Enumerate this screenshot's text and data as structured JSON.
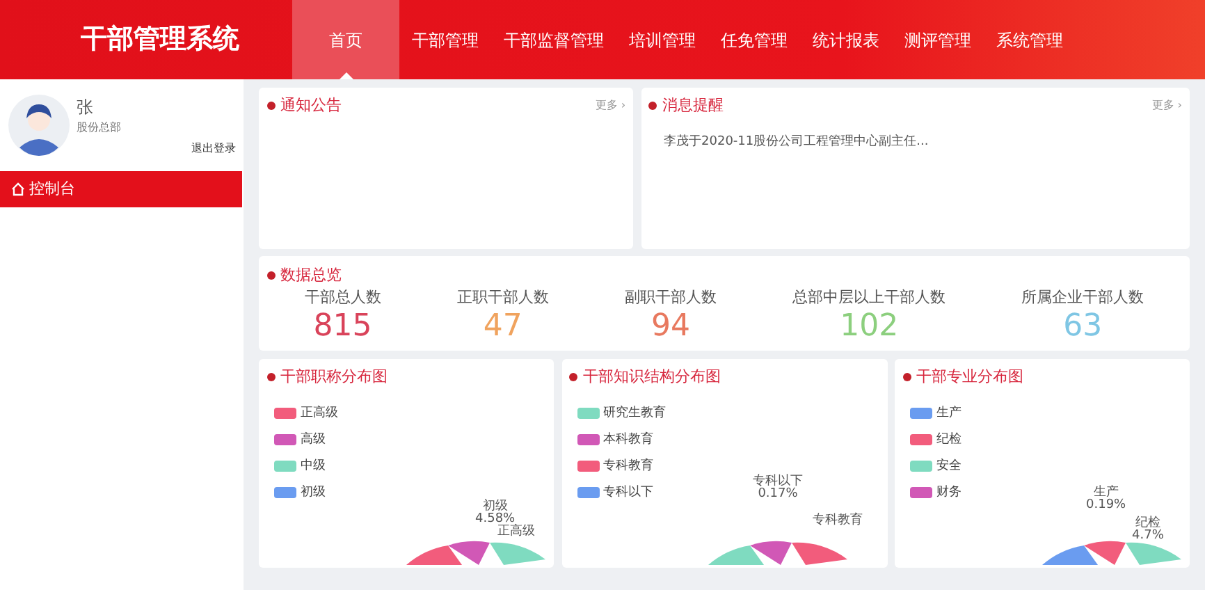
{
  "header": {
    "title": "干部管理系统",
    "nav": [
      {
        "label": "首页",
        "selected": true
      },
      {
        "label": "干部管理",
        "selected": false
      },
      {
        "label": "干部监督管理",
        "selected": false
      },
      {
        "label": "培训管理",
        "selected": false
      },
      {
        "label": "任免管理",
        "selected": false
      },
      {
        "label": "统计报表",
        "selected": false
      },
      {
        "label": "测评管理",
        "selected": false
      },
      {
        "label": "系统管理",
        "selected": false
      }
    ]
  },
  "user": {
    "name": "张",
    "role": "股份总部",
    "logout": "退出登录"
  },
  "sidebar": {
    "items": [
      {
        "label": "控制台",
        "selected": true
      }
    ]
  },
  "panels": [
    {
      "title": "通知公告",
      "more": "更多 ›"
    },
    {
      "title": "消息提醒",
      "more": "更多 ›",
      "items": [
        "李茂于2020-11股份公司工程管理中心副主任..."
      ]
    }
  ],
  "overview": {
    "title": "数据总览",
    "stats": [
      {
        "label": "干部总人数",
        "value": "815",
        "color": "#d9435a"
      },
      {
        "label": "正职干部人数",
        "value": "47",
        "color": "#f0a35e"
      },
      {
        "label": "副职干部人数",
        "value": "94",
        "color": "#e8795f"
      },
      {
        "label": "总部中层以上干部人数",
        "value": "102",
        "color": "#8ccf7e"
      },
      {
        "label": "所属企业干部人数",
        "value": "63",
        "color": "#7fc6e4"
      }
    ]
  },
  "charts": [
    {
      "title": "干部职称分布图",
      "legend": [
        {
          "label": "正高级",
          "color": "#f25c7c"
        },
        {
          "label": "高级",
          "color": "#d158b6"
        },
        {
          "label": "中级",
          "color": "#7fdbc0"
        },
        {
          "label": "初级",
          "color": "#6a9cf0"
        }
      ],
      "callouts": [
        {
          "name": "初级",
          "value": "4.58%"
        },
        {
          "name": "正高级"
        }
      ]
    },
    {
      "title": "干部知识结构分布图",
      "legend": [
        {
          "label": "研究生教育",
          "color": "#7fdbc0"
        },
        {
          "label": "本科教育",
          "color": "#d158b6"
        },
        {
          "label": "专科教育",
          "color": "#f25c7c"
        },
        {
          "label": "专科以下",
          "color": "#6a9cf0"
        }
      ],
      "callouts": [
        {
          "name": "专科以下",
          "value": "0.17%"
        },
        {
          "name": "专科教育"
        }
      ]
    },
    {
      "title": "干部专业分布图",
      "legend": [
        {
          "label": "生产",
          "color": "#6a9cf0"
        },
        {
          "label": "纪检",
          "color": "#f25c7c"
        },
        {
          "label": "安全",
          "color": "#7fdbc0"
        },
        {
          "label": "财务",
          "color": "#d158b6"
        }
      ],
      "callouts": [
        {
          "name": "生产",
          "value": "0.19%"
        },
        {
          "name": "纪检",
          "value": "4.7%"
        }
      ]
    }
  ]
}
